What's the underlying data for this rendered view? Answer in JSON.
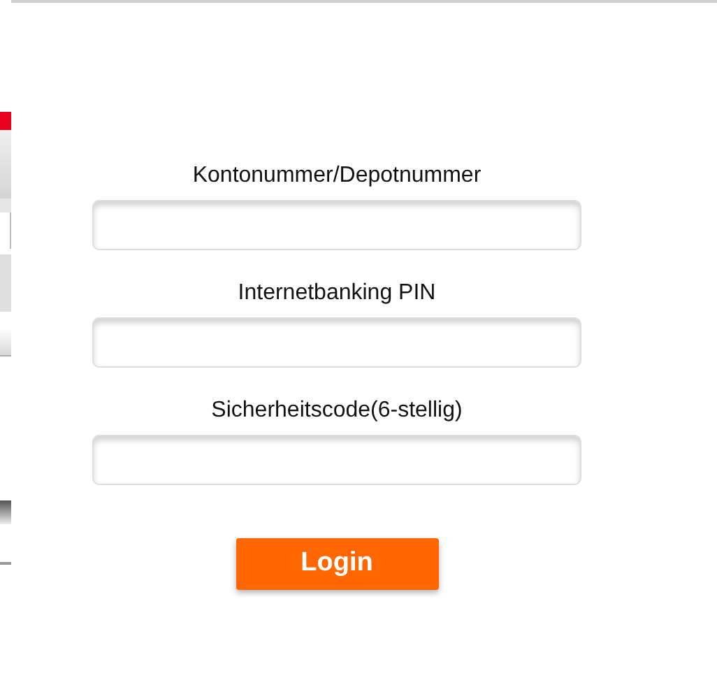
{
  "form": {
    "fields": [
      {
        "label": "Kontonummer/Depotnummer"
      },
      {
        "label": "Internetbanking PIN"
      },
      {
        "label": "Sicherheitscode(6-stellig)"
      }
    ],
    "submit_button": "Login"
  }
}
